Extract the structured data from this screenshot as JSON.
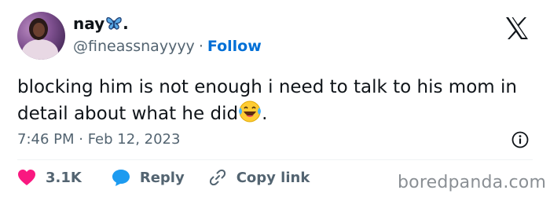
{
  "author": {
    "display_name": "nay",
    "name_suffix": ".",
    "handle": "@fineassnayyyy",
    "separator": "·",
    "follow_label": "Follow"
  },
  "tweet": {
    "text": "blocking him is not enough i need to talk to his mom in detail about what he did",
    "text_end": ".",
    "timestamp": "7:46 PM · Feb 12, 2023"
  },
  "actions": {
    "like_count": "3.1K",
    "reply_label": "Reply",
    "copy_link_label": "Copy link"
  },
  "watermark": "boredpanda.com",
  "colors": {
    "accent": "#006fd6",
    "like": "#f91880",
    "reply_icon": "#1d9bf0",
    "secondary_text": "#536471",
    "primary_text": "#0f1419"
  },
  "icons": [
    "x-logo-icon",
    "butterfly-emoji-icon",
    "laughing-tears-emoji-icon",
    "info-icon",
    "heart-icon",
    "reply-bubble-icon",
    "link-icon"
  ]
}
